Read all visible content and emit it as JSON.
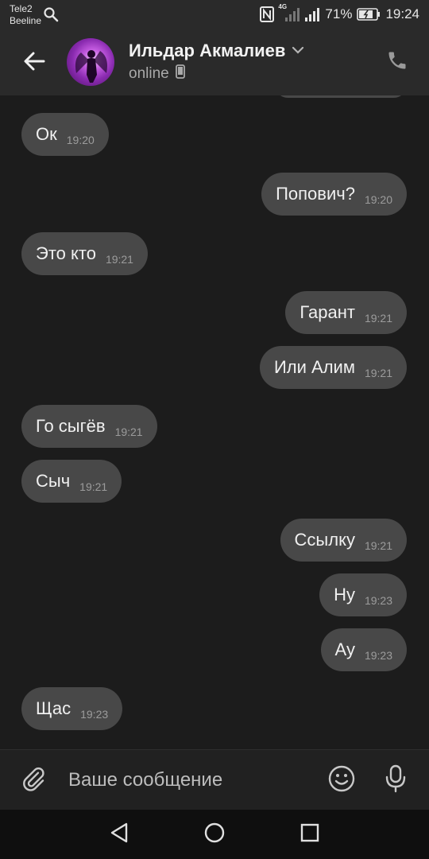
{
  "status_bar": {
    "carrier_1": "Tele2",
    "carrier_2": "Beeline",
    "network_badge": "4G",
    "battery_percent": "71%",
    "time": "19:24"
  },
  "header": {
    "contact_name": "Ильдар Акмалиев",
    "contact_status": "online"
  },
  "messages": [
    {
      "direction": "in",
      "text": "Ок",
      "time": "19:20"
    },
    {
      "direction": "out",
      "text": "Попович?",
      "time": "19:20"
    },
    {
      "direction": "in",
      "text": "Это кто",
      "time": "19:21"
    },
    {
      "direction": "out",
      "text": "Гарант",
      "time": "19:21"
    },
    {
      "direction": "out",
      "text": "Или Алим",
      "time": "19:21"
    },
    {
      "direction": "in",
      "text": "Го сыгёв",
      "time": "19:21"
    },
    {
      "direction": "in",
      "text": "Сыч",
      "time": "19:21"
    },
    {
      "direction": "out",
      "text": "Ссылку",
      "time": "19:21"
    },
    {
      "direction": "out",
      "text": "Ну",
      "time": "19:23"
    },
    {
      "direction": "out",
      "text": "Ау",
      "time": "19:23"
    },
    {
      "direction": "in",
      "text": "Щас",
      "time": "19:23"
    }
  ],
  "input": {
    "placeholder": "Ваше сообщение",
    "value": ""
  },
  "icons": {
    "back": "arrow-left-icon",
    "dropdown": "chevron-down-icon",
    "device": "phone-device-icon",
    "call": "phone-icon",
    "attach": "paperclip-icon",
    "emoji": "emoji-icon",
    "mic": "microphone-icon",
    "nav_back": "triangle-back-icon",
    "nav_home": "circle-home-icon",
    "nav_recent": "square-recent-icon"
  },
  "colors": {
    "background": "#1c1c1c",
    "header": "#2a2a2a",
    "bubble": "#484848",
    "nav_bar": "#0f0f0f"
  }
}
